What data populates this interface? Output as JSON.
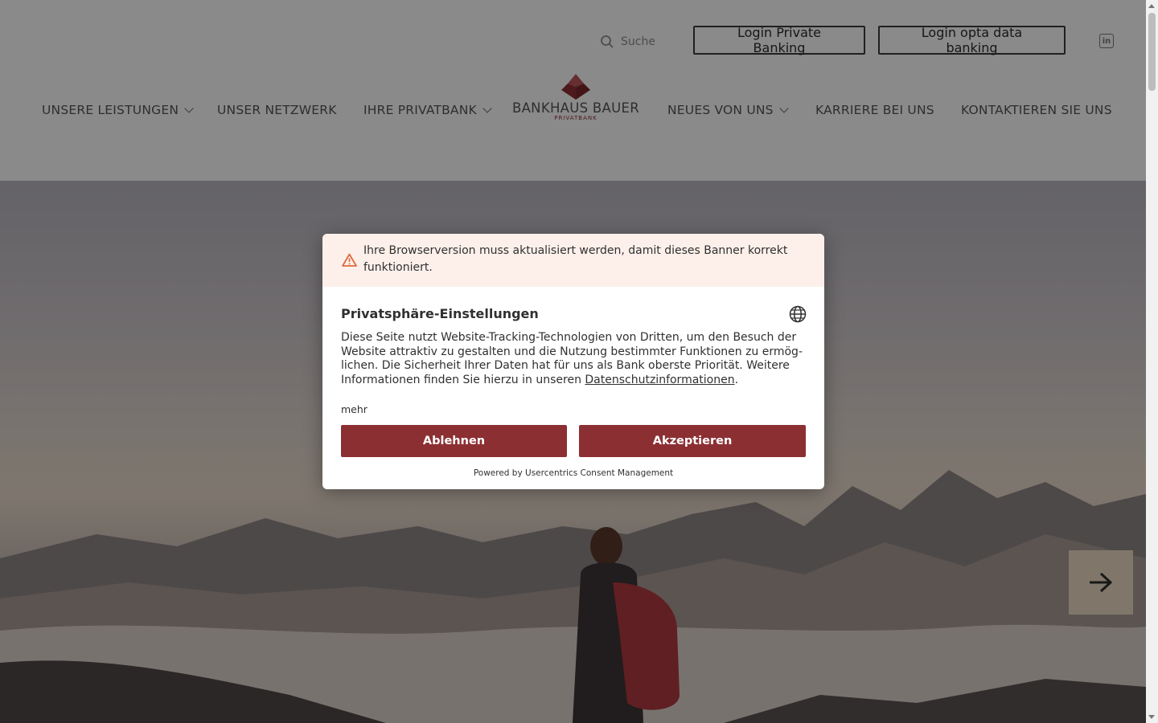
{
  "header": {
    "search_label": "Suche",
    "login_private": "Login Private Banking",
    "login_opta": "Login opta data banking",
    "linkedin_icon": "linkedin-icon",
    "logo": {
      "name": "BANKHAUS BAUER",
      "sub": "PRIVATBANK"
    },
    "nav": [
      {
        "label": "UNSERE LEISTUNGEN",
        "has_dropdown": true
      },
      {
        "label": "UNSER NETZWERK",
        "has_dropdown": false
      },
      {
        "label": "IHRE PRIVATBANK",
        "has_dropdown": true
      },
      {
        "label": "NEUES VON UNS",
        "has_dropdown": true
      },
      {
        "label": "KARRIERE BEI UNS",
        "has_dropdown": false
      },
      {
        "label": "KONTAKTIEREN SIE UNS",
        "has_dropdown": false
      }
    ]
  },
  "hero": {
    "next_icon": "arrow-right-icon"
  },
  "consent": {
    "warning": "Ihre Browserversion muss aktualisiert werden, damit dieses Banner korrekt funktioniert.",
    "title": "Privatsphäre-Einstellungen",
    "body": "Diese Seite nutzt Website-Tracking-Technologien von Dritten, um den Besuch der Website attraktiv zu gestalten und die Nutzung bestimmter Funktionen zu ermög­lichen. Die Sicherheit Ihrer Daten hat für uns als Bank oberste Priorität. Weitere Informationen finden Sie hierzu in unseren ",
    "body_link": "Datenschutzinformationen",
    "body_end": ".",
    "more": "mehr",
    "reject": "Ablehnen",
    "accept": "Akzeptieren",
    "powered": "Powered by Usercentrics Consent Management"
  },
  "colors": {
    "brand": "#8c2f33",
    "warning_bg": "#fdf0ea",
    "cta_bg": "#e9d8c2"
  }
}
